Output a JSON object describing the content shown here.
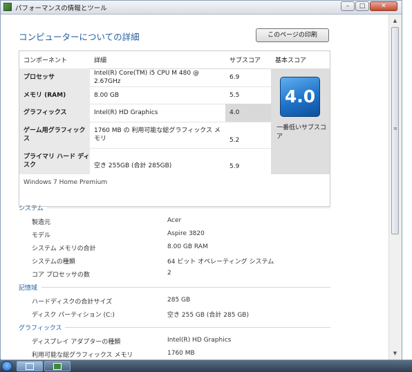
{
  "window": {
    "title": "パフォーマンスの情報とツール",
    "minimize": "–",
    "maximize": "□",
    "close": "✕"
  },
  "page": {
    "heading": "コンピューターについての詳細",
    "print_button": "このページの印刷"
  },
  "score_table": {
    "headers": {
      "component": "コンポーネント",
      "detail": "詳細",
      "subscore": "サブスコア",
      "base": "基本スコア"
    },
    "rows": [
      {
        "component": "プロセッサ",
        "detail": "Intel(R) Core(TM) i5 CPU M 480 @ 2.67GHz",
        "subscore": "6.9"
      },
      {
        "component": "メモリ (RAM)",
        "detail": "8.00 GB",
        "subscore": "5.5"
      },
      {
        "component": "グラフィックス",
        "detail": "Intel(R) HD Graphics",
        "subscore": "4.0"
      },
      {
        "component": "ゲーム用グラフィックス",
        "detail": "1760 MB の 利用可能な総グラフィックス メモリ",
        "subscore": "5.2"
      },
      {
        "component": "プライマリ ハード ディスク",
        "detail": "空き 255GB (合計 285GB)",
        "subscore": "5.9"
      }
    ],
    "base_score": "4.0",
    "base_label": "一番低いサブスコア",
    "os": "Windows 7 Home Premium"
  },
  "system": {
    "title": "システム",
    "items": [
      {
        "label": "製造元",
        "value": "Acer"
      },
      {
        "label": "モデル",
        "value": "Aspire 3820"
      },
      {
        "label": "システム メモリの合計",
        "value": "8.00 GB RAM"
      },
      {
        "label": "システムの種類",
        "value": "64 ビット オペレーティング システム"
      },
      {
        "label": "コア プロセッサの数",
        "value": "2"
      }
    ]
  },
  "storage": {
    "title": "記憶域",
    "items": [
      {
        "label": "ハードディスクの合計サイズ",
        "value": "285 GB"
      },
      {
        "label": "ディスク パーティション (C:)",
        "value": "空き 255 GB (合計 285 GB)"
      }
    ]
  },
  "graphics": {
    "title": "グラフィックス",
    "items": [
      {
        "label": "ディスプレイ アダプターの種類",
        "value": "Intel(R) HD Graphics"
      },
      {
        "label": "利用可能な総グラフィックス メモリ",
        "value": "1760 MB"
      }
    ]
  },
  "scrollbar": {
    "up": "▲",
    "down": "▼",
    "grip": "≡"
  },
  "colors": {
    "accent": "#1f5f9e",
    "badge": "#1f73c9"
  }
}
